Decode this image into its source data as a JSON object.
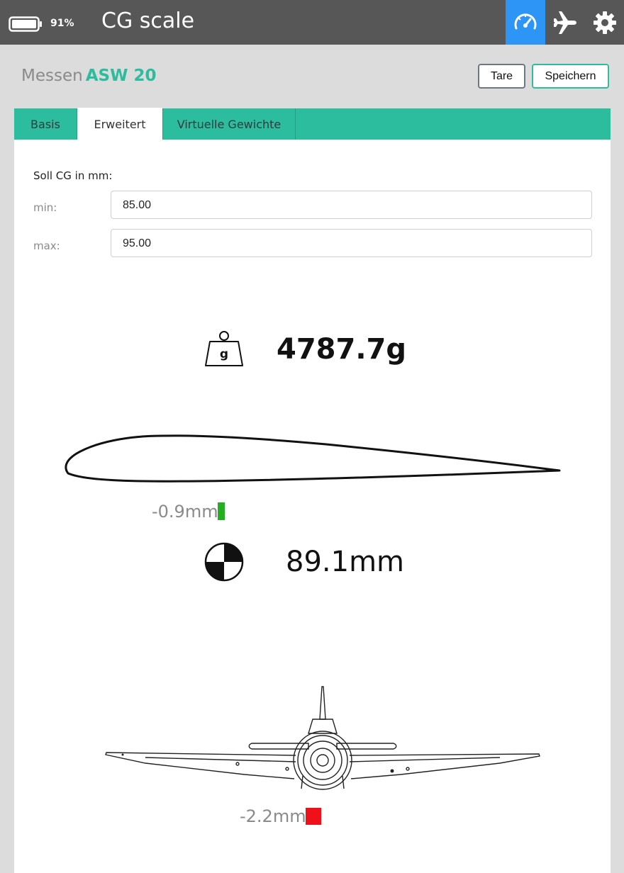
{
  "topbar": {
    "battery_pct": "91%",
    "title": "CG scale",
    "nav": [
      {
        "icon": "speedometer-icon",
        "active": true
      },
      {
        "icon": "airplane-icon",
        "active": false
      },
      {
        "icon": "gear-icon",
        "active": false
      }
    ]
  },
  "header": {
    "label": "Messen",
    "model": "ASW 20",
    "tare_label": "Tare",
    "save_label": "Speichern"
  },
  "tabs": [
    {
      "label": "Basis",
      "active": false
    },
    {
      "label": "Erweitert",
      "active": true
    },
    {
      "label": "Virtuelle Gewichte",
      "active": false
    }
  ],
  "form": {
    "soll_label": "Soll CG in mm:",
    "min_label": "min:",
    "min_value": "85.00",
    "max_label": "max:",
    "max_value": "95.00"
  },
  "readout": {
    "weight_icon_text": "g",
    "weight": "4787.7g",
    "wing_deviation": "-0.9mm",
    "wing_status_color": "#22b022",
    "cg": "89.1mm",
    "lateral_deviation": "-2.2mm",
    "lateral_status_color": "#f0101a"
  },
  "colors": {
    "accent": "#2bbd9e",
    "topbar": "#575757",
    "active_nav": "#2d95f5"
  }
}
